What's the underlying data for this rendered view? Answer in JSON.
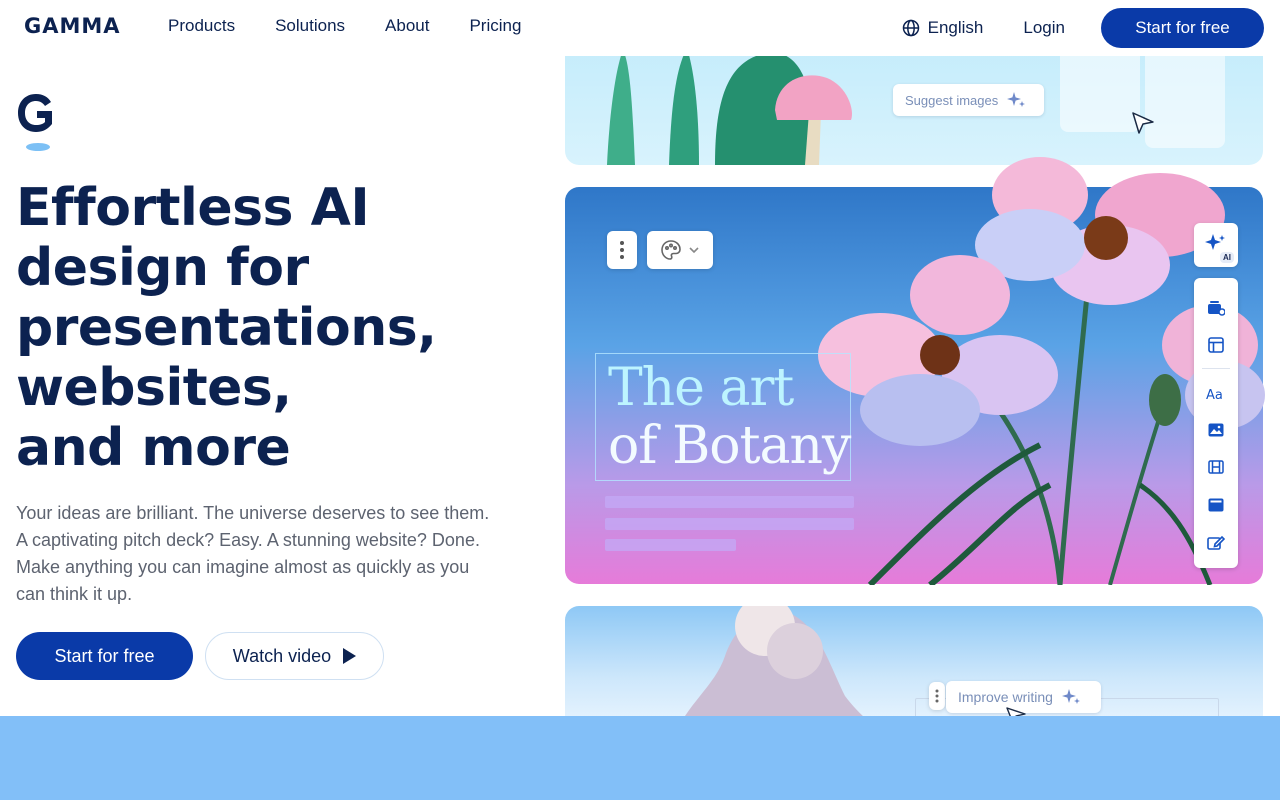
{
  "nav": {
    "logo": "GAMMA",
    "links": [
      "Products",
      "Solutions",
      "About",
      "Pricing"
    ],
    "language": "English",
    "login": "Login",
    "cta": "Start for free"
  },
  "hero": {
    "title_lines": [
      "Effortless AI",
      "design for",
      "presentations,",
      "websites,",
      "and more"
    ],
    "subtitle_lines": [
      "Your ideas are brilliant. The universe deserves to see them.",
      "A captivating pitch deck? Easy. A stunning website? Done.",
      "Make anything you can imagine almost as quickly as you",
      "can think it up."
    ],
    "cta_primary": "Start for free",
    "cta_secondary": "Watch video"
  },
  "showcase": {
    "suggest_images": "Suggest images",
    "art_title_1": "The art",
    "art_title_2": "of Botany",
    "ai_badge": "AI",
    "improve_writing": "Improve writing"
  },
  "colors": {
    "brand_navy": "#0c2250",
    "brand_blue": "#0a3aa8",
    "band": "#82bff8"
  },
  "icons": {
    "globe": "globe-icon",
    "play": "play-icon",
    "sparkle": "sparkle-icon",
    "kebab": "kebab-menu-icon",
    "palette": "palette-icon",
    "chevron": "chevron-down-icon",
    "cursor": "cursor-arrow-icon"
  }
}
